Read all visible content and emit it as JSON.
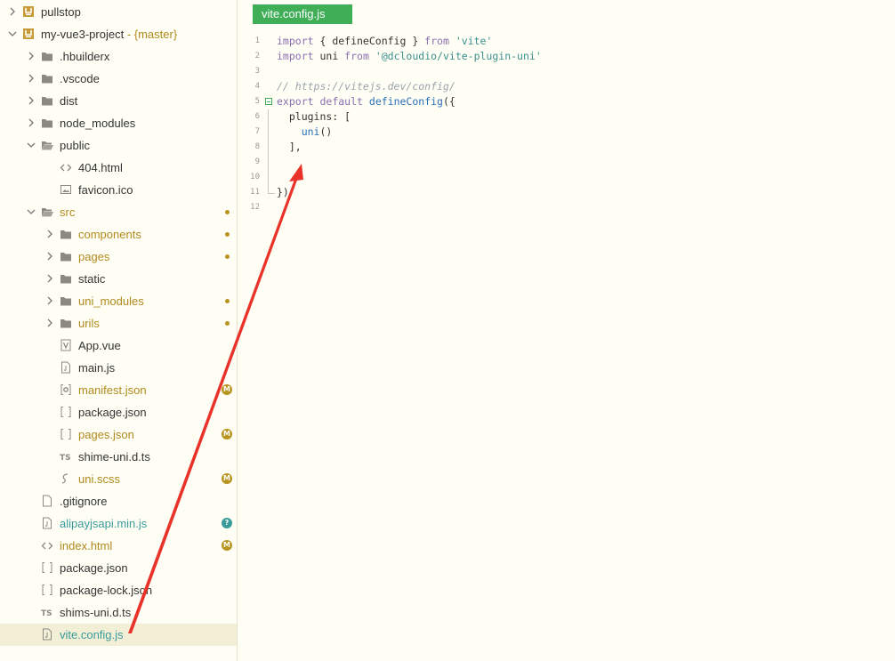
{
  "sidebar": {
    "items": [
      {
        "label": "pullstop",
        "icon": "project-icon",
        "chevron": "right",
        "x": 46
      },
      {
        "label": "my-vue3-project",
        "branch": " - {master}",
        "icon": "project-icon",
        "chevron": "down",
        "x": 46
      },
      {
        "label": ".hbuilderx",
        "icon": "folder-icon",
        "chevron": "right",
        "x": 67
      },
      {
        "label": ".vscode",
        "icon": "folder-icon",
        "chevron": "right",
        "x": 67
      },
      {
        "label": "dist",
        "icon": "folder-icon",
        "chevron": "right",
        "x": 67
      },
      {
        "label": "node_modules",
        "icon": "folder-icon",
        "chevron": "right",
        "x": 67
      },
      {
        "label": "public",
        "icon": "folder-open-icon",
        "chevron": "down",
        "x": 67
      },
      {
        "label": "404.html",
        "icon": "html-file-icon",
        "x": 88
      },
      {
        "label": "favicon.ico",
        "icon": "image-file-icon",
        "x": 88
      },
      {
        "label": "src",
        "icon": "folder-open-icon",
        "chevron": "down",
        "x": 67,
        "status": "modified",
        "marker": "dot"
      },
      {
        "label": "components",
        "icon": "folder-icon",
        "chevron": "right",
        "x": 88,
        "status": "modified",
        "marker": "dot"
      },
      {
        "label": "pages",
        "icon": "folder-icon",
        "chevron": "right",
        "x": 88,
        "status": "modified",
        "marker": "dot"
      },
      {
        "label": "static",
        "icon": "folder-icon",
        "chevron": "right",
        "x": 88
      },
      {
        "label": "uni_modules",
        "icon": "folder-icon",
        "chevron": "right",
        "x": 88,
        "status": "modified",
        "marker": "dot"
      },
      {
        "label": "urils",
        "icon": "folder-icon",
        "chevron": "right",
        "x": 88,
        "status": "modified",
        "marker": "dot"
      },
      {
        "label": "App.vue",
        "icon": "vue-file-icon",
        "x": 88
      },
      {
        "label": "main.js",
        "icon": "js-file-icon",
        "x": 88
      },
      {
        "label": "manifest.json",
        "icon": "manifest-file-icon",
        "x": 88,
        "status": "modified",
        "marker": "M"
      },
      {
        "label": "package.json",
        "icon": "json-file-icon",
        "x": 88
      },
      {
        "label": "pages.json",
        "icon": "json-file-icon",
        "x": 88,
        "status": "modified",
        "marker": "M"
      },
      {
        "label": "shime-uni.d.ts",
        "icon": "ts-file-icon",
        "x": 88
      },
      {
        "label": "uni.scss",
        "icon": "scss-file-icon",
        "x": 88,
        "status": "modified",
        "marker": "M"
      },
      {
        "label": ".gitignore",
        "icon": "file-icon",
        "x": 67
      },
      {
        "label": "alipayjsapi.min.js",
        "icon": "js-file-icon",
        "x": 67,
        "status": "untracked",
        "marker": "?"
      },
      {
        "label": "index.html",
        "icon": "html-file-icon",
        "x": 67,
        "status": "modified",
        "marker": "M"
      },
      {
        "label": "package.json",
        "icon": "json-file-icon",
        "x": 67
      },
      {
        "label": "package-lock.json",
        "icon": "json-file-icon",
        "x": 67
      },
      {
        "label": "shims-uni.d.ts",
        "icon": "ts-file-icon",
        "x": 67
      },
      {
        "label": "vite.config.js",
        "icon": "js-file-icon",
        "x": 67,
        "status": "untracked",
        "selected": true
      }
    ]
  },
  "editor": {
    "tab_label": "vite.config.js",
    "lines": [
      {
        "n": "1",
        "tokens": [
          [
            "kw",
            "import"
          ],
          [
            "p",
            " { defineConfig } "
          ],
          [
            "kw",
            "from"
          ],
          [
            "p",
            " "
          ],
          [
            "str",
            "'vite'"
          ]
        ]
      },
      {
        "n": "2",
        "tokens": [
          [
            "kw",
            "import"
          ],
          [
            "p",
            " uni "
          ],
          [
            "kw",
            "from"
          ],
          [
            "p",
            " "
          ],
          [
            "str",
            "'@dcloudio/vite-plugin-uni'"
          ]
        ]
      },
      {
        "n": "3",
        "tokens": []
      },
      {
        "n": "4",
        "tokens": [
          [
            "com",
            "// https://vitejs.dev/config/"
          ]
        ]
      },
      {
        "n": "5",
        "fold": true,
        "tokens": [
          [
            "kw",
            "export"
          ],
          [
            "p",
            " "
          ],
          [
            "kw",
            "default"
          ],
          [
            "p",
            " "
          ],
          [
            "fn",
            "defineConfig"
          ],
          [
            "p",
            "({"
          ]
        ]
      },
      {
        "n": "6",
        "tokens": [
          [
            "p",
            "  plugins: ["
          ]
        ]
      },
      {
        "n": "7",
        "tokens": [
          [
            "p",
            "    "
          ],
          [
            "fn",
            "uni"
          ],
          [
            "p",
            "()"
          ]
        ]
      },
      {
        "n": "8",
        "tokens": [
          [
            "p",
            "  ],"
          ]
        ]
      },
      {
        "n": "9",
        "tokens": []
      },
      {
        "n": "10",
        "tokens": []
      },
      {
        "n": "11",
        "tokens": [
          [
            "p",
            "})"
          ]
        ]
      },
      {
        "n": "12",
        "tokens": []
      }
    ]
  },
  "colors": {
    "accent_green": "#3fae57",
    "modified": "#b08a1e",
    "untracked": "#3a9b9b",
    "annotation_arrow": "#e8322a"
  }
}
